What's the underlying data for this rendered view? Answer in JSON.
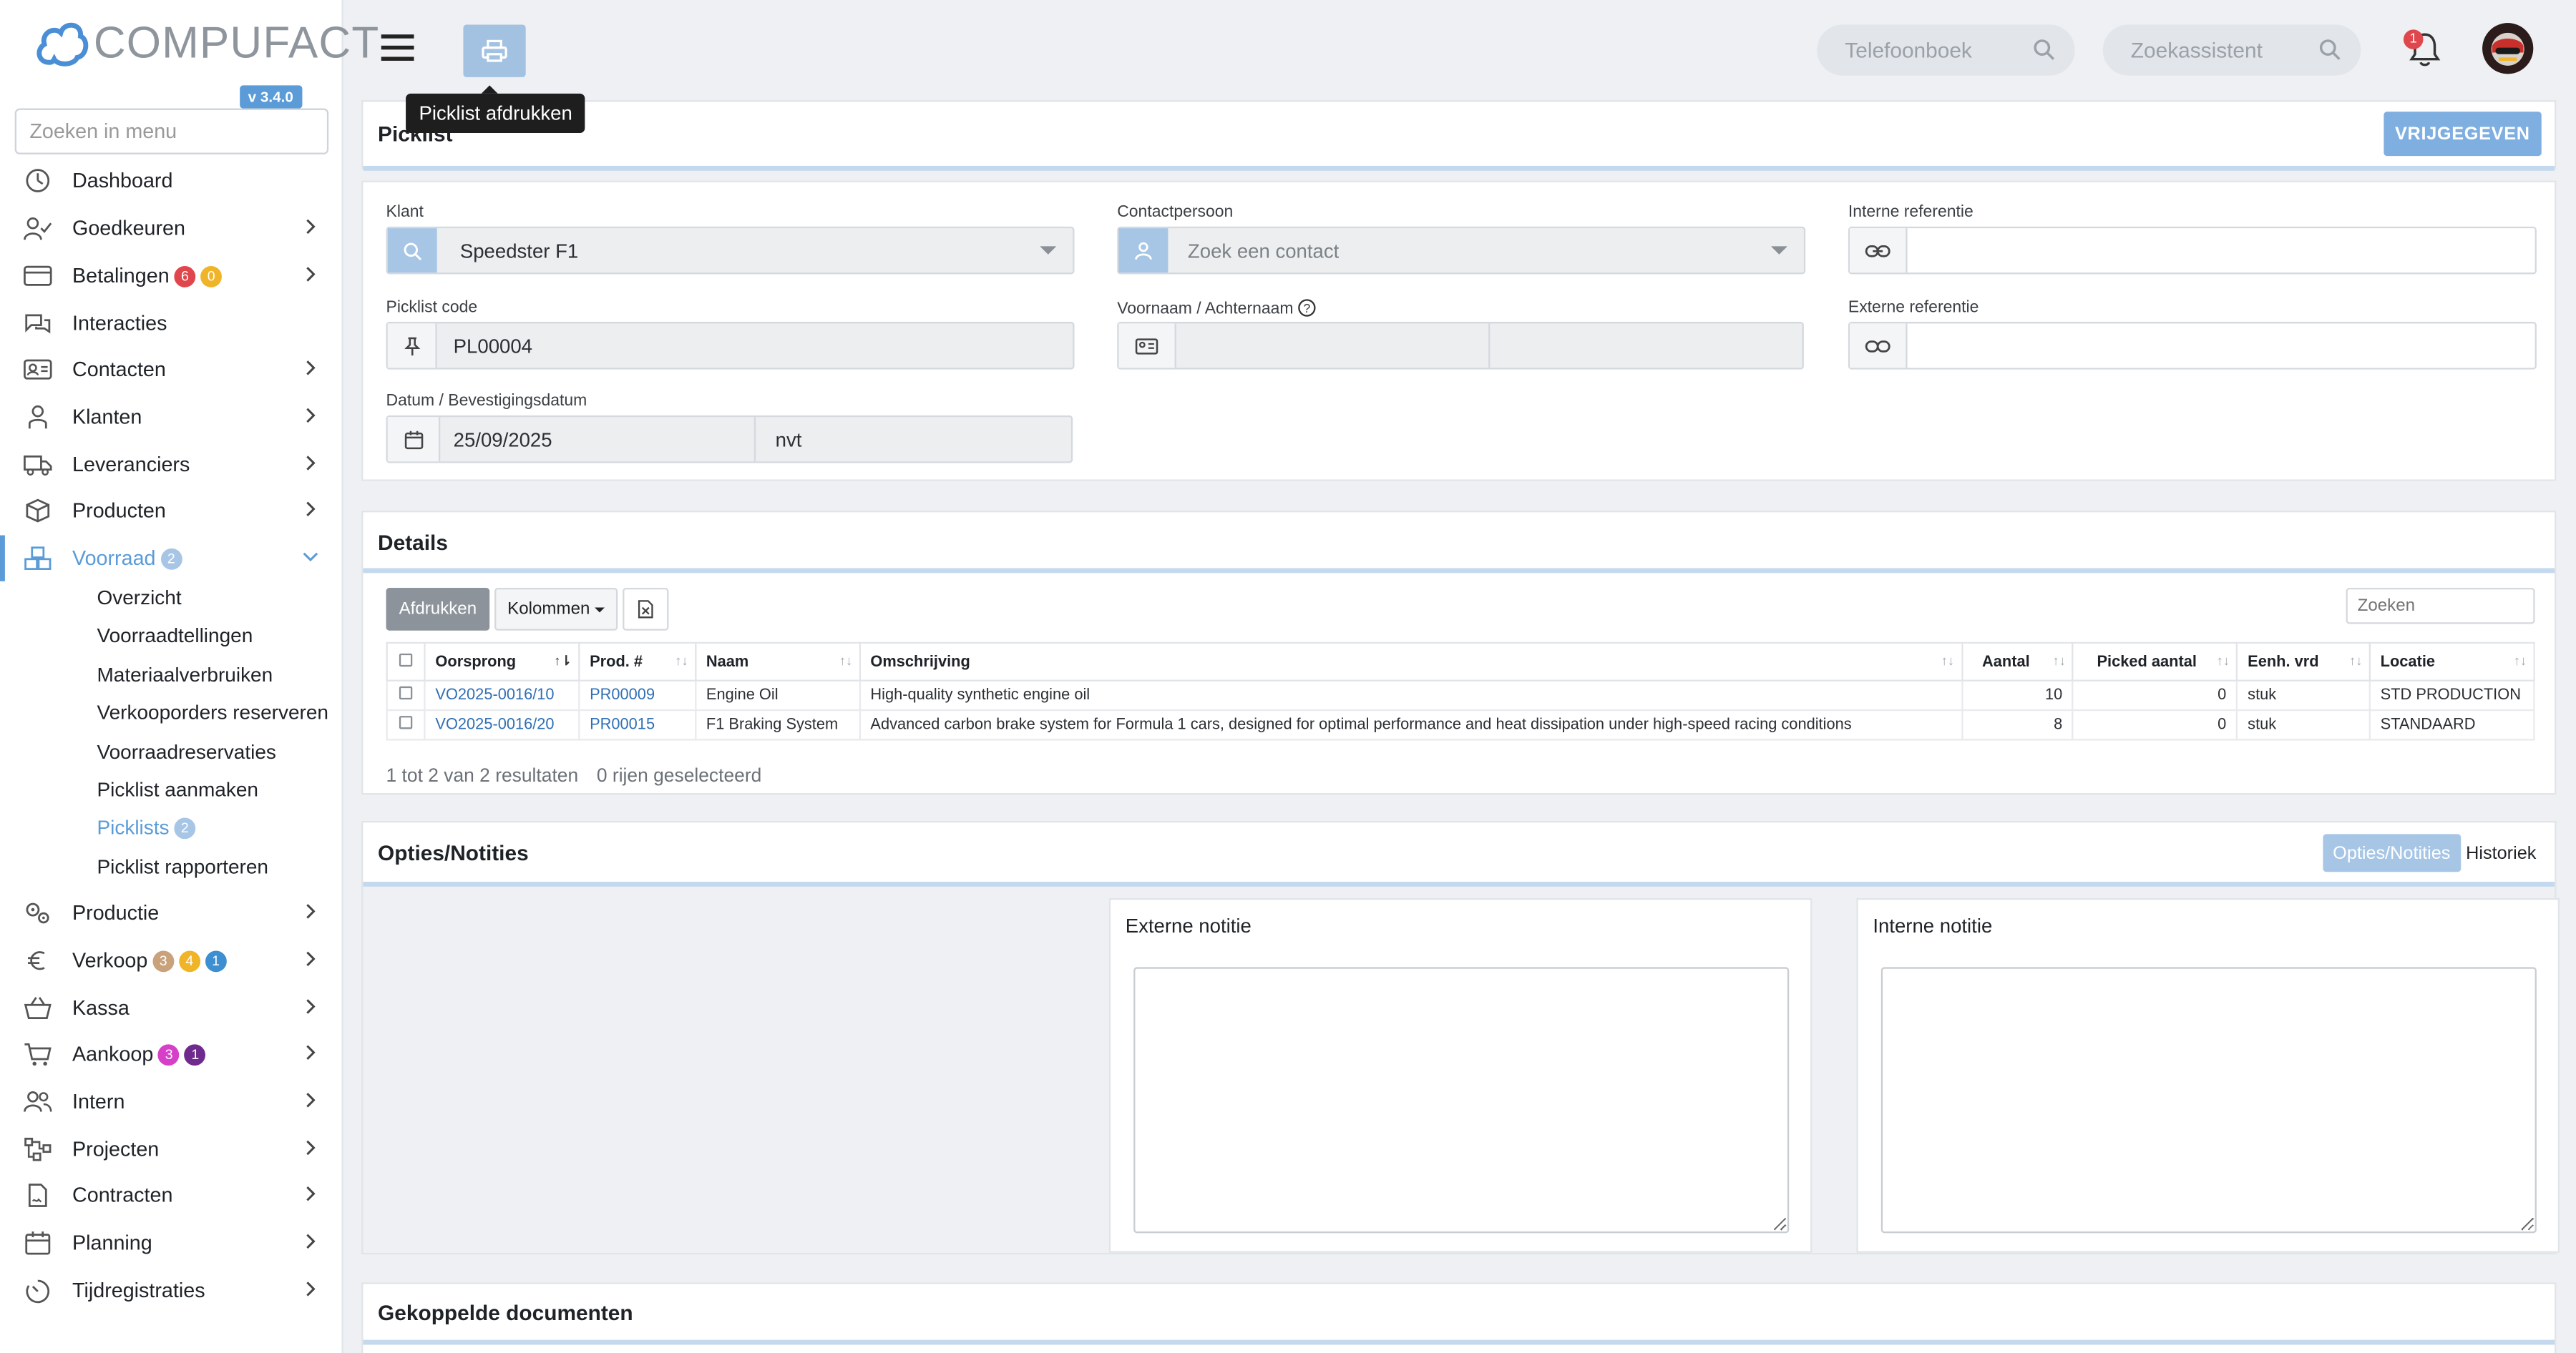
{
  "app": {
    "brand": "COMPUFACT",
    "version": "v 3.4.0"
  },
  "sidebar": {
    "search_placeholder": "Zoeken in menu",
    "items": [
      {
        "label": "Dashboard"
      },
      {
        "label": "Goedkeuren"
      },
      {
        "label": "Betalingen",
        "badges": [
          "6",
          "0"
        ]
      },
      {
        "label": "Interacties"
      },
      {
        "label": "Contacten"
      },
      {
        "label": "Klanten"
      },
      {
        "label": "Leveranciers"
      },
      {
        "label": "Producten"
      },
      {
        "label": "Voorraad",
        "badges": [
          "2"
        ]
      },
      {
        "label": "Productie"
      },
      {
        "label": "Verkoop",
        "badges": [
          "3",
          "4",
          "1"
        ]
      },
      {
        "label": "Kassa"
      },
      {
        "label": "Aankoop",
        "badges": [
          "3",
          "1"
        ]
      },
      {
        "label": "Intern"
      },
      {
        "label": "Projecten"
      },
      {
        "label": "Contracten"
      },
      {
        "label": "Planning"
      },
      {
        "label": "Tijdregistraties"
      }
    ],
    "voorraad_sub": [
      {
        "label": "Overzicht"
      },
      {
        "label": "Voorraadtellingen"
      },
      {
        "label": "Materiaalverbruiken"
      },
      {
        "label": "Verkooporders reserveren"
      },
      {
        "label": "Voorraadreservaties"
      },
      {
        "label": "Picklist aanmaken"
      },
      {
        "label": "Picklists",
        "badge": "2"
      },
      {
        "label": "Picklist rapporteren"
      }
    ]
  },
  "topbar": {
    "tooltip": "Picklist afdrukken",
    "phonebook_placeholder": "Telefoonboek",
    "assistant_placeholder": "Zoekassistent",
    "notifications_count": "1"
  },
  "picklist": {
    "title": "Picklist",
    "release_button": "VRIJGEGEVEN",
    "klant_label": "Klant",
    "klant_value": "Speedster F1",
    "contact_label": "Contactpersoon",
    "contact_placeholder": "Zoek een contact",
    "interne_ref_label": "Interne referentie",
    "code_label": "Picklist code",
    "code_value": "PL00004",
    "name_label": "Voornaam / Achternaam",
    "externe_ref_label": "Externe referentie",
    "date_label": "Datum / Bevestigingsdatum",
    "date_value": "25/09/2025",
    "confirm_value": "nvt"
  },
  "details": {
    "title": "Details",
    "print_button": "Afdrukken",
    "columns_button": "Kolommen",
    "search_placeholder": "Zoeken",
    "headers": [
      "Oorsprong",
      "Prod. #",
      "Naam",
      "Omschrijving",
      "Aantal",
      "Picked aantal",
      "Eenh. vrd",
      "Locatie"
    ],
    "rows": [
      [
        "VO2025-0016/10",
        "PR00009",
        "Engine Oil",
        "High-quality synthetic engine oil",
        "10",
        "0",
        "stuk",
        "STD PRODUCTION"
      ],
      [
        "VO2025-0016/20",
        "PR00015",
        "F1 Braking System",
        "Advanced carbon brake system for Formula 1 cars, designed for optimal performance and heat dissipation under high-speed racing conditions",
        "8",
        "0",
        "stuk",
        "STANDAARD"
      ]
    ],
    "results_text": "1 tot 2 van 2 resultaten",
    "selected_text": "0 rijen geselecteerd"
  },
  "options": {
    "title": "Opties/Notities",
    "tab_options": "Opties/Notities",
    "tab_history": "Historiek",
    "external_note": "Externe notitie",
    "internal_note": "Interne notitie"
  },
  "documents": {
    "title": "Gekoppelde documenten"
  },
  "colors": {
    "accent": "#5a9bd8",
    "red": "#e0474c",
    "orange": "#f0b429",
    "tan": "#c9a27c",
    "blue": "#3d8fd1",
    "magenta": "#d63fc8",
    "purple": "#6e2a8c"
  }
}
